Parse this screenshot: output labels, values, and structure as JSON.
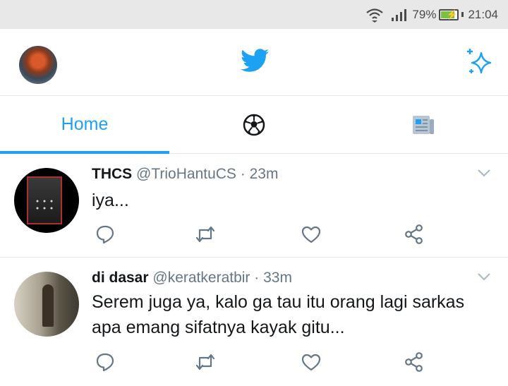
{
  "status_bar": {
    "battery_percent": "79%",
    "battery_level": 0.79,
    "time": "21:04",
    "icons": [
      "wifi-icon",
      "signal-icon",
      "battery-charging-icon"
    ]
  },
  "header": {
    "icons": [
      "profile-avatar",
      "twitter-bird-icon",
      "sparkle-icon"
    ],
    "accent_color": "#1da1f2"
  },
  "tabs": [
    {
      "label": "Home",
      "active": true
    },
    {
      "icon": "soccer-ball-icon",
      "active": false
    },
    {
      "icon": "newspaper-icon",
      "active": false
    }
  ],
  "tweets": [
    {
      "name": "THCS",
      "handle": "@TrioHantuCS",
      "separator": "·",
      "time": "23m",
      "lines": [
        "iya..."
      ]
    },
    {
      "name": "di dasar",
      "handle": "@keratkeratbir",
      "separator": "·",
      "time": "33m",
      "lines": [
        "Serem juga ya, kalo ga tau itu orang lagi sarkas",
        "apa emang sifatnya kayak gitu..."
      ]
    }
  ],
  "tweet_actions": [
    "reply-icon",
    "retweet-icon",
    "like-icon",
    "share-icon"
  ]
}
